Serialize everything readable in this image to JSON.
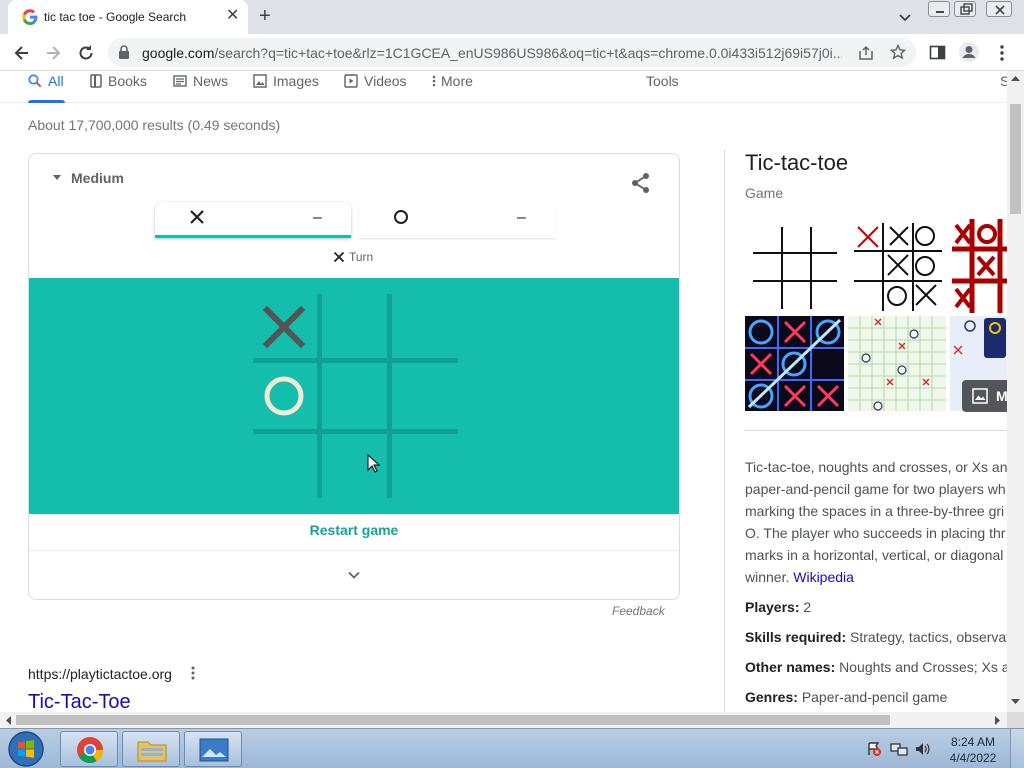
{
  "browser": {
    "tab_title": "tic tac toe - Google Search",
    "close_tab": "✕",
    "new_tab": "+",
    "url_host": "google.com",
    "url_path": "/search?q=tic+tac+toe&rlz=1C1GCEA_enUS986US986&oq=tic+t&aqs=chrome.0.0i433i512j69i57j0i..."
  },
  "search_nav": {
    "items": [
      {
        "label": "All",
        "icon": "search-icon"
      },
      {
        "label": "Books",
        "icon": "book-icon"
      },
      {
        "label": "News",
        "icon": "news-icon"
      },
      {
        "label": "Images",
        "icon": "image-icon"
      },
      {
        "label": "Videos",
        "icon": "video-icon"
      },
      {
        "label": "More",
        "icon": "more-vert-icon"
      }
    ],
    "tools": "Tools",
    "right_cut": "S"
  },
  "result_stats": "About 17,700,000 results (0.49 seconds)",
  "game": {
    "difficulty": "Medium",
    "score_x": "–",
    "score_o": "–",
    "turn_label": "Turn",
    "board": [
      "X",
      "",
      "",
      "O",
      "",
      "",
      "",
      "",
      ""
    ],
    "restart": "Restart game",
    "board_color": "#14bdac"
  },
  "feedback": "Feedback",
  "result": {
    "url": "https://playtictactoe.org",
    "title": "Tic-Tac-Toe"
  },
  "knowledge_panel": {
    "title": "Tic-tac-toe",
    "subtitle": "Game",
    "more_images_label": "M",
    "description_lines": [
      "Tic-tac-toe, noughts and crosses, or Xs an",
      "paper-and-pencil game for two players wh",
      "marking the spaces in a three-by-three gri",
      "O. The player who succeeds in placing thr",
      "marks in a horizontal, vertical, or diagonal",
      "winner."
    ],
    "source_link": "Wikipedia",
    "facts": [
      {
        "label": "Players:",
        "value": "2"
      },
      {
        "label": "Skills required:",
        "value": "Strategy, tactics, observati"
      },
      {
        "label": "Other names:",
        "value": "Noughts and Crosses; Xs ar"
      },
      {
        "label": "Genres:",
        "value": "Paper-and-pencil game"
      }
    ]
  },
  "taskbar": {
    "time": "8:24 AM",
    "date": "4/4/2022"
  }
}
